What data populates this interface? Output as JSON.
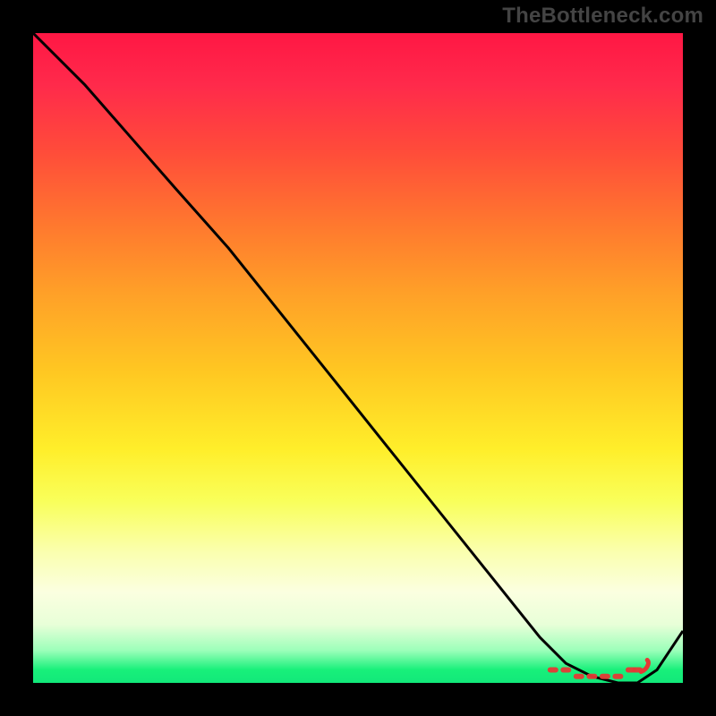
{
  "watermark": "TheBottleneck.com",
  "chart_data": {
    "type": "line",
    "title": "",
    "xlabel": "",
    "ylabel": "",
    "xlim": [
      0,
      100
    ],
    "ylim": [
      0,
      100
    ],
    "grid": false,
    "legend": false,
    "series": [
      {
        "name": "bottleneck-curve",
        "x": [
          0,
          8,
          15,
          22,
          30,
          38,
          46,
          54,
          62,
          70,
          78,
          82,
          86,
          90,
          93,
          96,
          100
        ],
        "values": [
          100,
          92,
          84,
          76,
          67,
          57,
          47,
          37,
          27,
          17,
          7,
          3,
          1,
          0,
          0,
          2,
          8
        ]
      }
    ],
    "markers": {
      "name": "optimal-range",
      "x": [
        80,
        82,
        84,
        86,
        88,
        90,
        92,
        93
      ],
      "values": [
        2,
        2,
        1,
        1,
        1,
        1,
        2,
        2
      ]
    },
    "gradient_colors": {
      "top": "#ff1744",
      "mid": "#ffee2a",
      "bottom": "#12e87a"
    }
  }
}
